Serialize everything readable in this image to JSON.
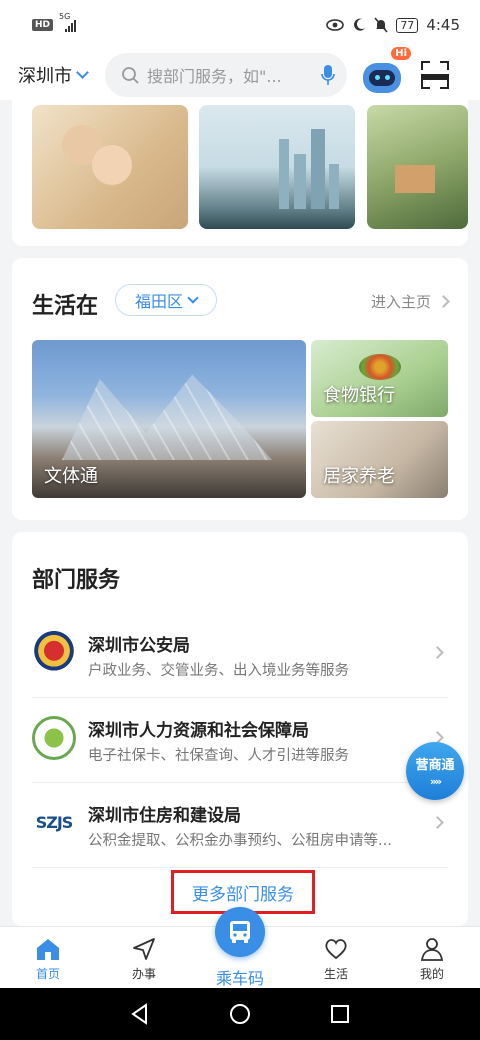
{
  "status_bar": {
    "hd": "HD",
    "network": "5G",
    "battery": "77",
    "time": "4:45"
  },
  "header": {
    "city": "深圳市",
    "search_placeholder": "搜部门服务，如\"...",
    "robot_badge": "Hi"
  },
  "life_section": {
    "title": "生活在",
    "district": "福田区",
    "home_link": "进入主页",
    "tiles": [
      {
        "label": "文体通"
      },
      {
        "label": "食物银行"
      },
      {
        "label": "居家养老"
      }
    ]
  },
  "dept_section": {
    "title": "部门服务",
    "items": [
      {
        "name": "深圳市公安局",
        "desc": "户政业务、交管业务、出入境业务等服务"
      },
      {
        "name": "深圳市人力资源和社会保障局",
        "desc": "电子社保卡、社保查询、人才引进等服务"
      },
      {
        "name": "深圳市住房和建设局",
        "desc": "公积金提取、公积金办事预约、公租房申请等...",
        "logo_text": "SZJS"
      }
    ],
    "more_label": "更多部门服务"
  },
  "float_button": {
    "label": "营商通",
    "arrows": "»»"
  },
  "bottom_nav": [
    {
      "label": "首页",
      "active": true
    },
    {
      "label": "办事",
      "active": false
    },
    {
      "label": "乘车码",
      "active": false
    },
    {
      "label": "生活",
      "active": false
    },
    {
      "label": "我的",
      "active": false
    }
  ],
  "colors": {
    "accent": "#3a8ee6",
    "highlight_border": "#e02020"
  }
}
